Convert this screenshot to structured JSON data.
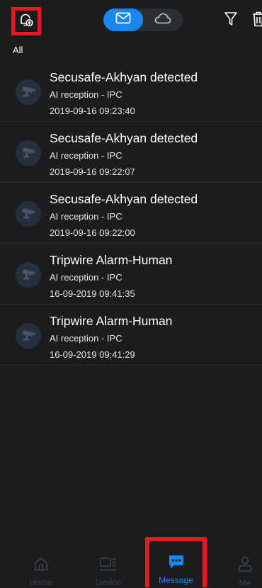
{
  "header": {
    "bell_icon": "bell-settings-icon",
    "tabs": [
      {
        "icon": "mail-icon",
        "active": true
      },
      {
        "icon": "cloud-icon",
        "active": false
      }
    ],
    "filter_icon": "filter-icon",
    "delete_icon": "trash-icon",
    "filter_label": "All"
  },
  "messages": [
    {
      "title": "Secusafe-Akhyan detected",
      "source": "AI reception - IPC",
      "time": "2019-09-16 09:23:40",
      "icon": "camera-icon"
    },
    {
      "title": "Secusafe-Akhyan detected",
      "source": "AI reception - IPC",
      "time": "2019-09-16 09:22:07",
      "icon": "camera-icon"
    },
    {
      "title": "Secusafe-Akhyan detected",
      "source": "AI reception - IPC",
      "time": "2019-09-16 09:22:00",
      "icon": "camera-icon"
    },
    {
      "title": "Tripwire Alarm-Human",
      "source": "AI reception - IPC",
      "time": "16-09-2019 09:41:35",
      "icon": "camera-icon"
    },
    {
      "title": "Tripwire Alarm-Human",
      "source": "AI reception - IPC",
      "time": "16-09-2019 09:41:29",
      "icon": "camera-icon"
    }
  ],
  "bottom_nav": [
    {
      "label": "Home",
      "icon": "home-icon",
      "active": false
    },
    {
      "label": "Device",
      "icon": "device-icon",
      "active": false
    },
    {
      "label": "Message",
      "icon": "message-icon",
      "active": true
    },
    {
      "label": "Me",
      "icon": "user-icon",
      "active": false
    }
  ],
  "colors": {
    "background": "#1b1c1e",
    "accent": "#1a86f0",
    "highlight": "#e8191f",
    "inactive": "#3d4148"
  }
}
